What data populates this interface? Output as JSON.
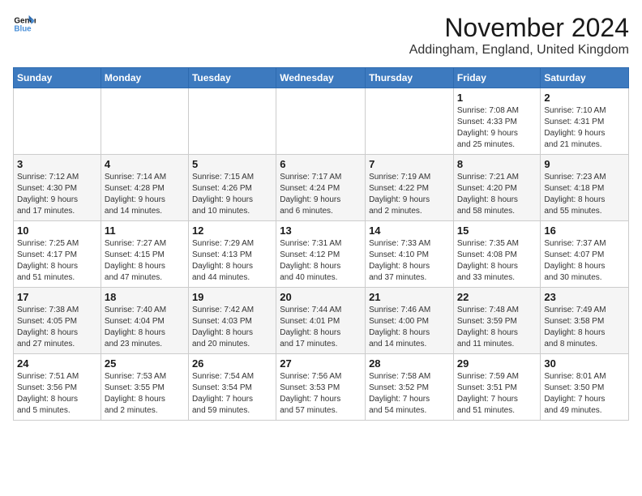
{
  "logo": {
    "line1": "General",
    "line2": "Blue"
  },
  "title": "November 2024",
  "location": "Addingham, England, United Kingdom",
  "weekdays": [
    "Sunday",
    "Monday",
    "Tuesday",
    "Wednesday",
    "Thursday",
    "Friday",
    "Saturday"
  ],
  "weeks": [
    [
      {
        "day": "",
        "info": ""
      },
      {
        "day": "",
        "info": ""
      },
      {
        "day": "",
        "info": ""
      },
      {
        "day": "",
        "info": ""
      },
      {
        "day": "",
        "info": ""
      },
      {
        "day": "1",
        "info": "Sunrise: 7:08 AM\nSunset: 4:33 PM\nDaylight: 9 hours\nand 25 minutes."
      },
      {
        "day": "2",
        "info": "Sunrise: 7:10 AM\nSunset: 4:31 PM\nDaylight: 9 hours\nand 21 minutes."
      }
    ],
    [
      {
        "day": "3",
        "info": "Sunrise: 7:12 AM\nSunset: 4:30 PM\nDaylight: 9 hours\nand 17 minutes."
      },
      {
        "day": "4",
        "info": "Sunrise: 7:14 AM\nSunset: 4:28 PM\nDaylight: 9 hours\nand 14 minutes."
      },
      {
        "day": "5",
        "info": "Sunrise: 7:15 AM\nSunset: 4:26 PM\nDaylight: 9 hours\nand 10 minutes."
      },
      {
        "day": "6",
        "info": "Sunrise: 7:17 AM\nSunset: 4:24 PM\nDaylight: 9 hours\nand 6 minutes."
      },
      {
        "day": "7",
        "info": "Sunrise: 7:19 AM\nSunset: 4:22 PM\nDaylight: 9 hours\nand 2 minutes."
      },
      {
        "day": "8",
        "info": "Sunrise: 7:21 AM\nSunset: 4:20 PM\nDaylight: 8 hours\nand 58 minutes."
      },
      {
        "day": "9",
        "info": "Sunrise: 7:23 AM\nSunset: 4:18 PM\nDaylight: 8 hours\nand 55 minutes."
      }
    ],
    [
      {
        "day": "10",
        "info": "Sunrise: 7:25 AM\nSunset: 4:17 PM\nDaylight: 8 hours\nand 51 minutes."
      },
      {
        "day": "11",
        "info": "Sunrise: 7:27 AM\nSunset: 4:15 PM\nDaylight: 8 hours\nand 47 minutes."
      },
      {
        "day": "12",
        "info": "Sunrise: 7:29 AM\nSunset: 4:13 PM\nDaylight: 8 hours\nand 44 minutes."
      },
      {
        "day": "13",
        "info": "Sunrise: 7:31 AM\nSunset: 4:12 PM\nDaylight: 8 hours\nand 40 minutes."
      },
      {
        "day": "14",
        "info": "Sunrise: 7:33 AM\nSunset: 4:10 PM\nDaylight: 8 hours\nand 37 minutes."
      },
      {
        "day": "15",
        "info": "Sunrise: 7:35 AM\nSunset: 4:08 PM\nDaylight: 8 hours\nand 33 minutes."
      },
      {
        "day": "16",
        "info": "Sunrise: 7:37 AM\nSunset: 4:07 PM\nDaylight: 8 hours\nand 30 minutes."
      }
    ],
    [
      {
        "day": "17",
        "info": "Sunrise: 7:38 AM\nSunset: 4:05 PM\nDaylight: 8 hours\nand 27 minutes."
      },
      {
        "day": "18",
        "info": "Sunrise: 7:40 AM\nSunset: 4:04 PM\nDaylight: 8 hours\nand 23 minutes."
      },
      {
        "day": "19",
        "info": "Sunrise: 7:42 AM\nSunset: 4:03 PM\nDaylight: 8 hours\nand 20 minutes."
      },
      {
        "day": "20",
        "info": "Sunrise: 7:44 AM\nSunset: 4:01 PM\nDaylight: 8 hours\nand 17 minutes."
      },
      {
        "day": "21",
        "info": "Sunrise: 7:46 AM\nSunset: 4:00 PM\nDaylight: 8 hours\nand 14 minutes."
      },
      {
        "day": "22",
        "info": "Sunrise: 7:48 AM\nSunset: 3:59 PM\nDaylight: 8 hours\nand 11 minutes."
      },
      {
        "day": "23",
        "info": "Sunrise: 7:49 AM\nSunset: 3:58 PM\nDaylight: 8 hours\nand 8 minutes."
      }
    ],
    [
      {
        "day": "24",
        "info": "Sunrise: 7:51 AM\nSunset: 3:56 PM\nDaylight: 8 hours\nand 5 minutes."
      },
      {
        "day": "25",
        "info": "Sunrise: 7:53 AM\nSunset: 3:55 PM\nDaylight: 8 hours\nand 2 minutes."
      },
      {
        "day": "26",
        "info": "Sunrise: 7:54 AM\nSunset: 3:54 PM\nDaylight: 7 hours\nand 59 minutes."
      },
      {
        "day": "27",
        "info": "Sunrise: 7:56 AM\nSunset: 3:53 PM\nDaylight: 7 hours\nand 57 minutes."
      },
      {
        "day": "28",
        "info": "Sunrise: 7:58 AM\nSunset: 3:52 PM\nDaylight: 7 hours\nand 54 minutes."
      },
      {
        "day": "29",
        "info": "Sunrise: 7:59 AM\nSunset: 3:51 PM\nDaylight: 7 hours\nand 51 minutes."
      },
      {
        "day": "30",
        "info": "Sunrise: 8:01 AM\nSunset: 3:50 PM\nDaylight: 7 hours\nand 49 minutes."
      }
    ]
  ]
}
